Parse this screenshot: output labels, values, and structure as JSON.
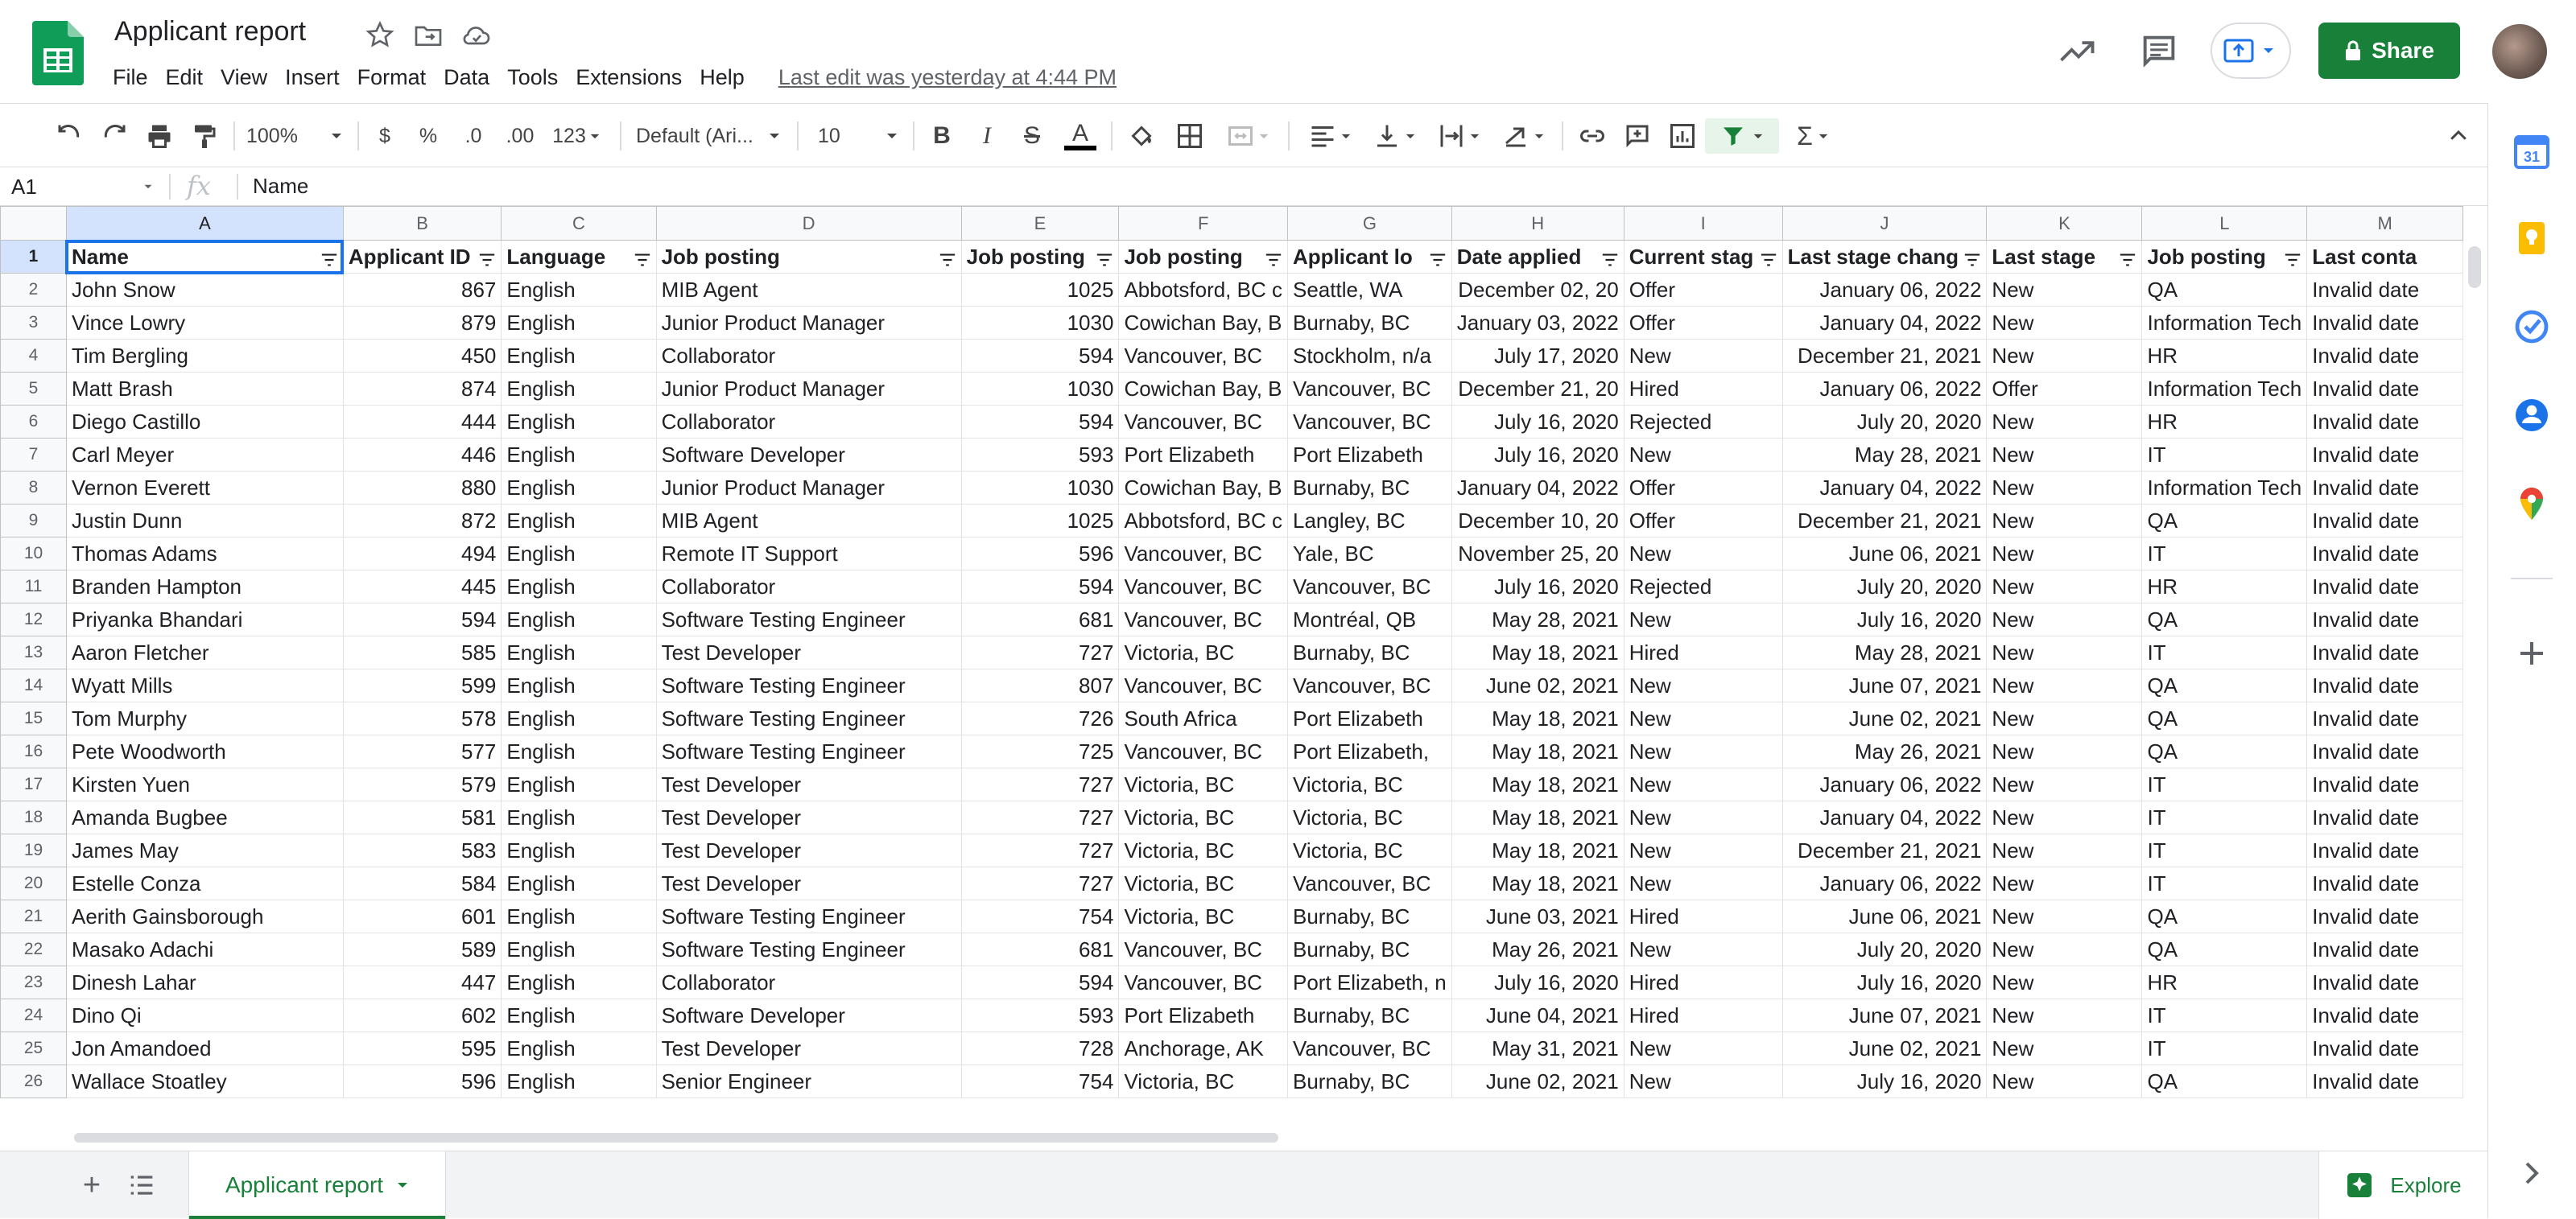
{
  "app": {
    "title": "Applicant report",
    "last_edit": "Last edit was yesterday at 4:44 PM",
    "share_label": "Share",
    "menu": [
      "File",
      "Edit",
      "View",
      "Insert",
      "Format",
      "Data",
      "Tools",
      "Extensions",
      "Help"
    ]
  },
  "toolbar": {
    "zoom": "100%",
    "currency": "$",
    "percent": "%",
    "dec_decrease": ".0",
    "dec_increase": ".00",
    "more_formats": "123",
    "font": "Default (Ari...",
    "font_size": "10",
    "bold": "B",
    "italic": "I",
    "strike": "S",
    "text_color": "A",
    "sum": "Σ"
  },
  "formula_bar": {
    "name_box": "A1",
    "fx": "fx",
    "content": "Name"
  },
  "grid": {
    "columns": [
      "A",
      "B",
      "C",
      "D",
      "E",
      "F",
      "G",
      "H",
      "I",
      "J",
      "K",
      "L",
      "M"
    ],
    "header": [
      "Name",
      "Applicant ID",
      "Language",
      "Job posting",
      "Job posting",
      "Job posting",
      "Applicant lo",
      "Date applied",
      "Current stag",
      "Last stage chang",
      "Last stage",
      "Job posting",
      "Last conta"
    ],
    "rows": [
      [
        "John Snow",
        "867",
        "English",
        "MIB Agent",
        "1025",
        "Abbotsford, BC c",
        "Seattle, WA",
        "December 02, 20",
        "Offer",
        "January 06, 2022",
        "New",
        "QA",
        "Invalid date"
      ],
      [
        "Vince Lowry",
        "879",
        "English",
        "Junior Product Manager",
        "1030",
        "Cowichan Bay, B",
        "Burnaby, BC",
        "January 03, 2022",
        "Offer",
        "January 04, 2022",
        "New",
        "Information Tech",
        "Invalid date"
      ],
      [
        "Tim Bergling",
        "450",
        "English",
        "Collaborator",
        "594",
        "Vancouver, BC",
        "Stockholm, n/a",
        "July 17, 2020",
        "New",
        "December 21, 2021",
        "New",
        "HR",
        "Invalid date"
      ],
      [
        "Matt Brash",
        "874",
        "English",
        "Junior Product Manager",
        "1030",
        "Cowichan Bay, B",
        "Vancouver, BC",
        "December 21, 20",
        "Hired",
        "January 06, 2022",
        "Offer",
        "Information Tech",
        "Invalid date"
      ],
      [
        "Diego Castillo",
        "444",
        "English",
        "Collaborator",
        "594",
        "Vancouver, BC",
        "Vancouver, BC",
        "July 16, 2020",
        "Rejected",
        "July 20, 2020",
        "New",
        "HR",
        "Invalid date"
      ],
      [
        "Carl Meyer",
        "446",
        "English",
        "Software Developer",
        "593",
        "Port Elizabeth",
        "Port Elizabeth",
        "July 16, 2020",
        "New",
        "May 28, 2021",
        "New",
        "IT",
        "Invalid date"
      ],
      [
        "Vernon Everett",
        "880",
        "English",
        "Junior Product Manager",
        "1030",
        "Cowichan Bay, B",
        "Burnaby, BC",
        "January 04, 2022",
        "Offer",
        "January 04, 2022",
        "New",
        "Information Tech",
        "Invalid date"
      ],
      [
        "Justin Dunn",
        "872",
        "English",
        "MIB Agent",
        "1025",
        "Abbotsford, BC c",
        "Langley, BC",
        "December 10, 20",
        "Offer",
        "December 21, 2021",
        "New",
        "QA",
        "Invalid date"
      ],
      [
        "Thomas Adams",
        "494",
        "English",
        "Remote IT Support",
        "596",
        "Vancouver, BC",
        "Yale, BC",
        "November 25, 20",
        "New",
        "June 06, 2021",
        "New",
        "IT",
        "Invalid date"
      ],
      [
        "Branden Hampton",
        "445",
        "English",
        "Collaborator",
        "594",
        "Vancouver, BC",
        "Vancouver, BC",
        "July 16, 2020",
        "Rejected",
        "July 20, 2020",
        "New",
        "HR",
        "Invalid date"
      ],
      [
        "Priyanka Bhandari",
        "594",
        "English",
        "Software Testing Engineer",
        "681",
        "Vancouver, BC",
        "Montréal, QB",
        "May 28, 2021",
        "New",
        "July 16, 2020",
        "New",
        "QA",
        "Invalid date"
      ],
      [
        "Aaron Fletcher",
        "585",
        "English",
        "Test Developer",
        "727",
        "Victoria, BC",
        "Burnaby, BC",
        "May 18, 2021",
        "Hired",
        "May 28, 2021",
        "New",
        "IT",
        "Invalid date"
      ],
      [
        "Wyatt Mills",
        "599",
        "English",
        "Software Testing Engineer",
        "807",
        "Vancouver, BC",
        "Vancouver, BC",
        "June 02, 2021",
        "New",
        "June 07, 2021",
        "New",
        "QA",
        "Invalid date"
      ],
      [
        "Tom Murphy",
        "578",
        "English",
        "Software Testing Engineer",
        "726",
        "South Africa",
        "Port Elizabeth",
        "May 18, 2021",
        "New",
        "June 02, 2021",
        "New",
        "QA",
        "Invalid date"
      ],
      [
        "Pete Woodworth",
        "577",
        "English",
        "Software Testing Engineer",
        "725",
        "Vancouver, BC",
        "Port Elizabeth,",
        "May 18, 2021",
        "New",
        "May 26, 2021",
        "New",
        "QA",
        "Invalid date"
      ],
      [
        "Kirsten Yuen",
        "579",
        "English",
        "Test Developer",
        "727",
        "Victoria, BC",
        "Victoria, BC",
        "May 18, 2021",
        "New",
        "January 06, 2022",
        "New",
        "IT",
        "Invalid date"
      ],
      [
        "Amanda Bugbee",
        "581",
        "English",
        "Test Developer",
        "727",
        "Victoria, BC",
        "Victoria, BC",
        "May 18, 2021",
        "New",
        "January 04, 2022",
        "New",
        "IT",
        "Invalid date"
      ],
      [
        "James May",
        "583",
        "English",
        "Test Developer",
        "727",
        "Victoria, BC",
        "Victoria, BC",
        "May 18, 2021",
        "New",
        "December 21, 2021",
        "New",
        "IT",
        "Invalid date"
      ],
      [
        "Estelle Conza",
        "584",
        "English",
        "Test Developer",
        "727",
        "Victoria, BC",
        "Vancouver, BC",
        "May 18, 2021",
        "New",
        "January 06, 2022",
        "New",
        "IT",
        "Invalid date"
      ],
      [
        "Aerith Gainsborough",
        "601",
        "English",
        "Software Testing Engineer",
        "754",
        "Victoria, BC",
        "Burnaby, BC",
        "June 03, 2021",
        "Hired",
        "June 06, 2021",
        "New",
        "QA",
        "Invalid date"
      ],
      [
        "Masako Adachi",
        "589",
        "English",
        "Software Testing Engineer",
        "681",
        "Vancouver, BC",
        "Burnaby, BC",
        "May 26, 2021",
        "New",
        "July 20, 2020",
        "New",
        "QA",
        "Invalid date"
      ],
      [
        "Dinesh Lahar",
        "447",
        "English",
        "Collaborator",
        "594",
        "Vancouver, BC",
        "Port Elizabeth, n",
        "July 16, 2020",
        "Hired",
        "July 16, 2020",
        "New",
        "HR",
        "Invalid date"
      ],
      [
        "Dino Qi",
        "602",
        "English",
        "Software Developer",
        "593",
        "Port Elizabeth",
        "Burnaby, BC",
        "June 04, 2021",
        "Hired",
        "June 07, 2021",
        "New",
        "IT",
        "Invalid date"
      ],
      [
        "Jon Amandoed",
        "595",
        "English",
        "Test Developer",
        "728",
        "Anchorage, AK",
        "Vancouver, BC",
        "May 31, 2021",
        "New",
        "June 02, 2021",
        "New",
        "IT",
        "Invalid date"
      ],
      [
        "Wallace Stoatley",
        "596",
        "English",
        "Senior Engineer",
        "754",
        "Victoria, BC",
        "Burnaby, BC",
        "June 02, 2021",
        "New",
        "July 16, 2020",
        "New",
        "QA",
        "Invalid date"
      ]
    ]
  },
  "sheet_tabs": {
    "active": "Applicant report",
    "add_label": "+",
    "explore_label": "Explore"
  },
  "colors": {
    "brand_green": "#188038",
    "selection_blue": "#1a73e8",
    "header_bg": "#f8f9fa"
  }
}
